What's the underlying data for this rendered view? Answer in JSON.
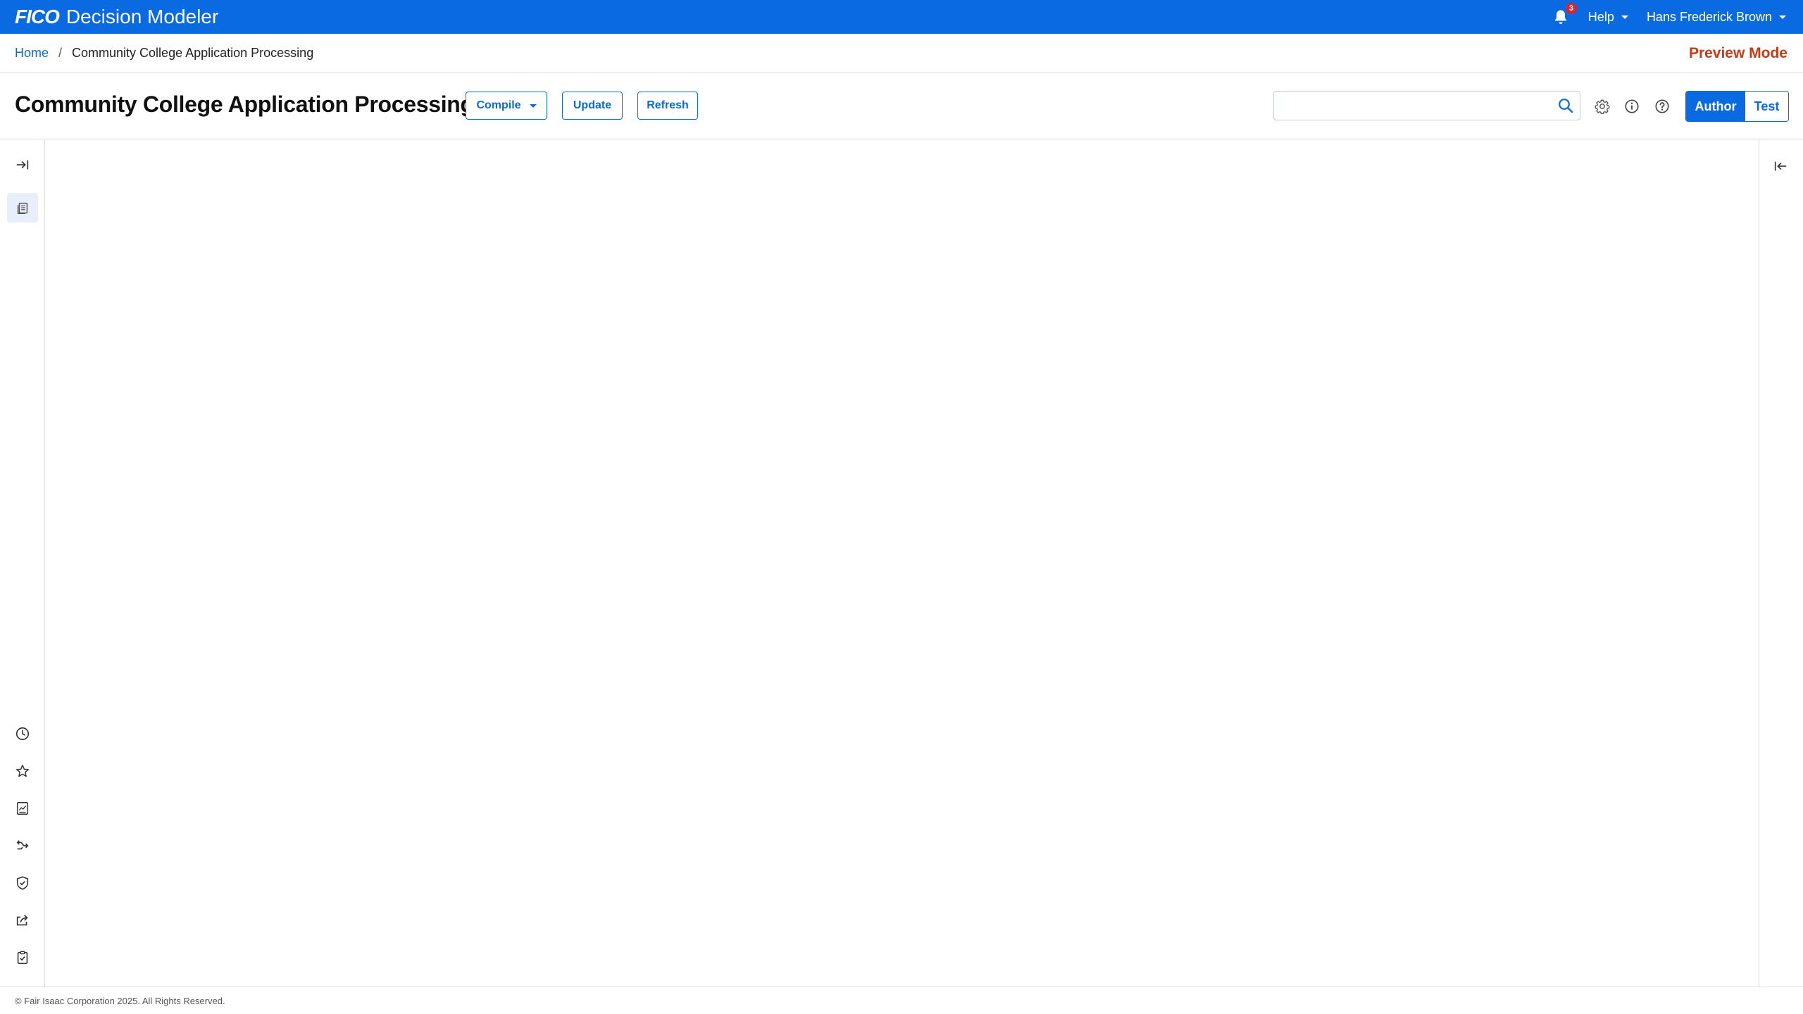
{
  "app": {
    "logo": "FICO",
    "name": "Decision Modeler"
  },
  "topbar": {
    "notifications_count": "3",
    "help_label": "Help",
    "user_name": "Hans Frederick Brown"
  },
  "breadcrumb": {
    "home": "Home",
    "separator": "/",
    "current": "Community College Application Processing"
  },
  "mode_banner": "Preview Mode",
  "page": {
    "title": "Community College Application Processing",
    "compile_label": "Compile",
    "update_label": "Update",
    "refresh_label": "Refresh",
    "search_value": "",
    "search_placeholder": ""
  },
  "view_toggle": {
    "author_label": "Author",
    "test_label": "Test",
    "selected": "Author"
  },
  "left_rail": {
    "top_items": [
      "expand-panel-icon",
      "documents-icon"
    ],
    "bottom_items": [
      "history-icon",
      "favorites-star-icon",
      "reports-icon",
      "merge-icon",
      "shield-check-icon",
      "share-icon",
      "clipboard-check-icon"
    ]
  },
  "right_rail": {
    "items": [
      "collapse-panel-icon"
    ]
  },
  "footer": {
    "copyright": "© Fair Isaac Corporation 2025. All Rights Reserved."
  },
  "colors": {
    "brand_blue": "#0a6ae2",
    "preview_orange": "#c83a16",
    "badge_red": "#d8262f"
  }
}
